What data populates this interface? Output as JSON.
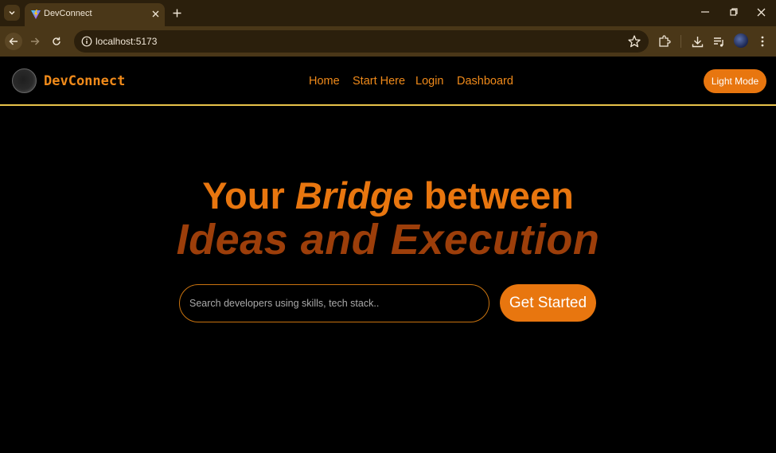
{
  "browser": {
    "tab_title": "DevConnect",
    "url": "localhost:5173"
  },
  "navbar": {
    "brand": "DevConnect",
    "links": [
      "Home",
      "Start Here",
      "Login",
      "Dashboard"
    ],
    "theme_button": "Light Mode"
  },
  "hero": {
    "line1_part1": "Your",
    "line1_part2": "Bridge",
    "line1_part3": "between",
    "line2": "Ideas and Execution"
  },
  "search": {
    "placeholder": "Search developers using skills, tech stack.."
  },
  "cta": {
    "label": "Get Started"
  },
  "colors": {
    "accent": "#e8760f",
    "accent_dark": "#9c3e0a",
    "nav_border": "#e8c34a",
    "background": "#000000",
    "chrome_dark": "#2b1f0c",
    "chrome_mid": "#4a3718"
  }
}
